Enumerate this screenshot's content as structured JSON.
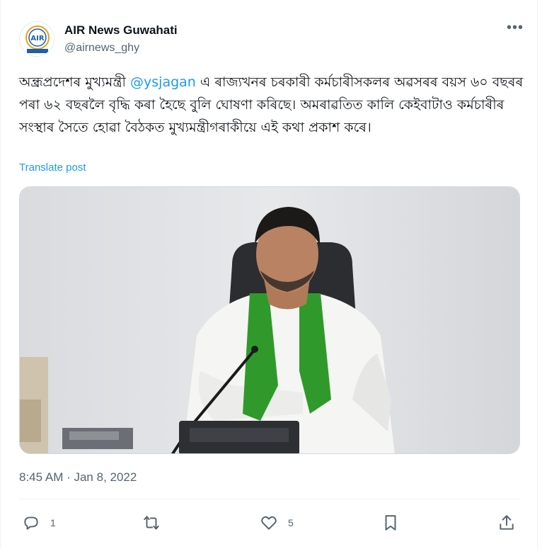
{
  "account": {
    "display_name": "AIR News Guwahati",
    "handle": "@airnews_ghy",
    "avatar_logo_text": "AIR"
  },
  "menu": {
    "more_label": "•••"
  },
  "tweet": {
    "text_before_mention": "অন্ধ্রপ্রদেশৰ মুখ্যমন্ত্ৰী ",
    "mention": "@ysjagan",
    "text_after_mention": " এ ৰাজ্যখনৰ চৰকাৰী কৰ্মচাৰীসকলৰ অৱসৰৰ বয়স ৬০ বছৰৰ পৰা ৬২ বছৰলৈ বৃদ্ধি কৰা হৈছে বুলি ঘোষণা কৰিছে। অমৰাৱতিত কালি কেইবাটাও কৰ্মচাৰীৰ সংস্থাৰ সৈতে হোৱা বৈঠকত মুখ্যমন্ত্ৰীগৰাকীয়ে এই কথা প্ৰকাশ কৰে।",
    "translate_label": "Translate post",
    "timestamp": "8:45 AM · Jan 8, 2022"
  },
  "actions": {
    "reply_count": "1",
    "retweet_count": "",
    "like_count": "5"
  },
  "colors": {
    "accent": "#1d9bf0",
    "secondary_text": "#536471",
    "scarf_green": "#2f9a2b"
  }
}
